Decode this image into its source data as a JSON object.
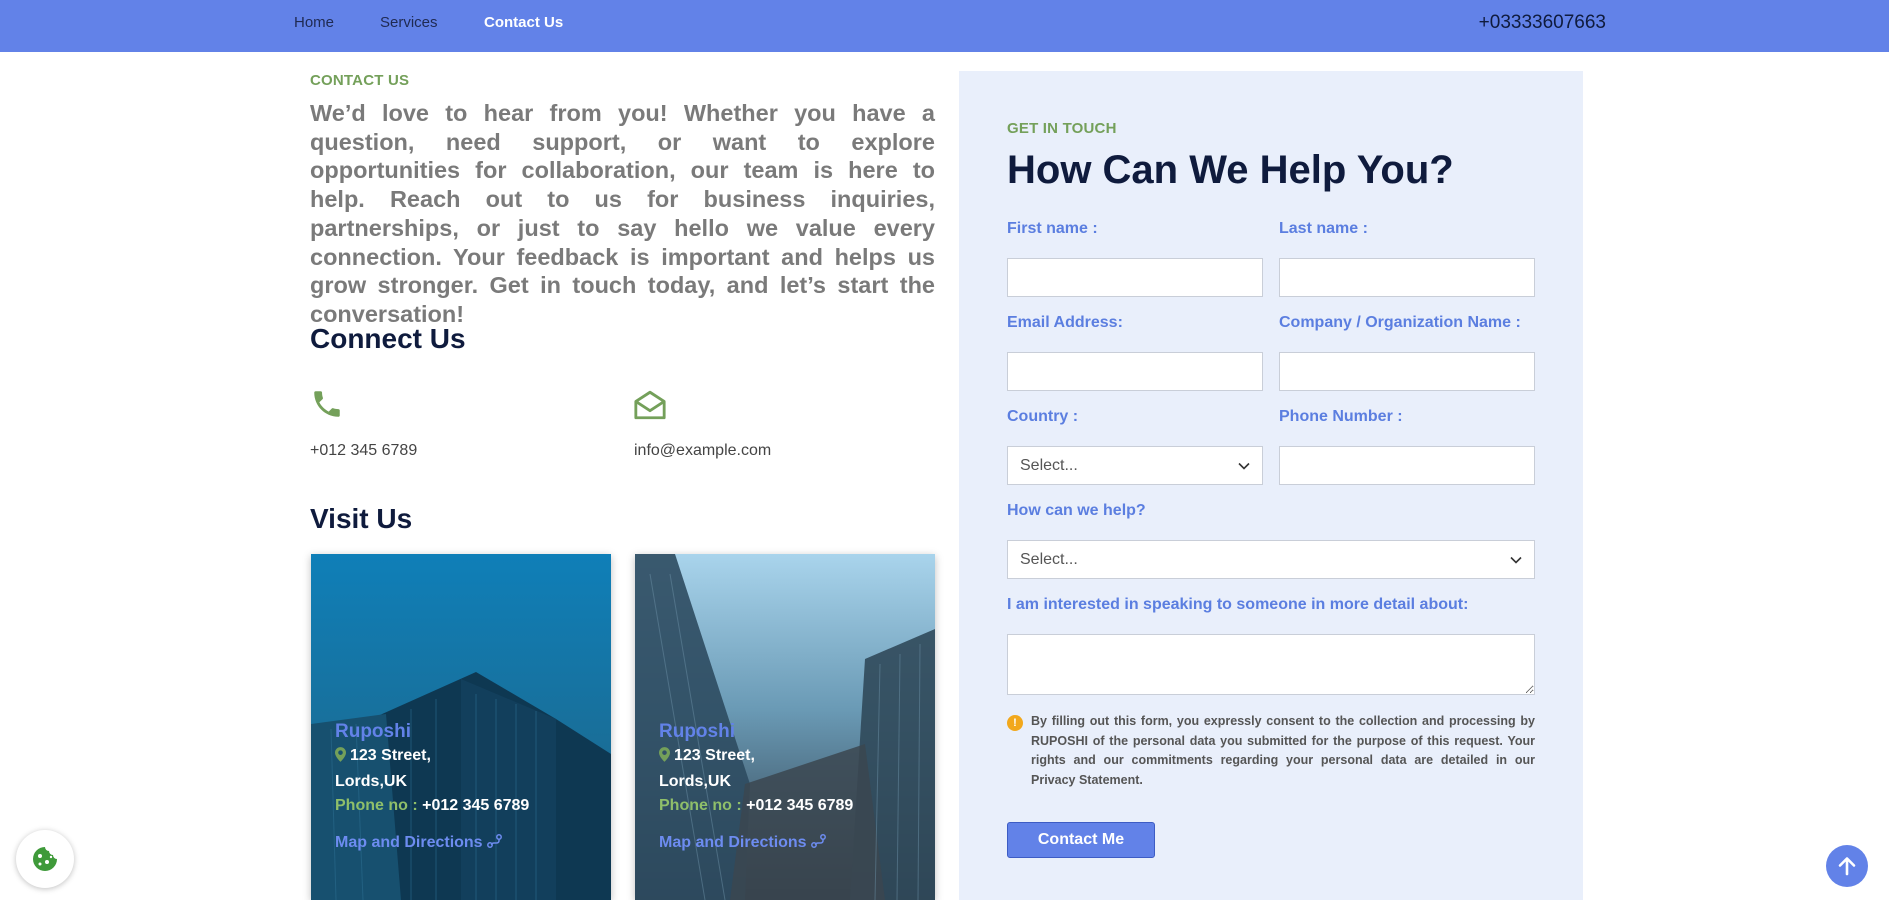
{
  "nav": {
    "home": "Home",
    "services": "Services",
    "contact": "Contact Us",
    "phone": "+03333607663"
  },
  "intro": {
    "eyebrow": "CONTACT US",
    "text": "We’d love to hear from you! Whether you have a question, need support, or want to explore opportunities for collaboration, our team is here to help. Reach out to us for business inquiries, partnerships, or just to say hello we value every connection. Your feedback is important and helps us grow stronger. Get in touch today, and let’s start the conversation!"
  },
  "connect": {
    "title": "Connect Us",
    "phone": "+012 345 6789",
    "email": "info@example.com"
  },
  "visit": {
    "title": "Visit Us",
    "cards": [
      {
        "name": "Ruposhi",
        "street": "123 Street,",
        "city": "Lords,UK",
        "phone_label": "Phone no :",
        "phone": "+012 345 6789",
        "link": "Map and Directions"
      },
      {
        "name": "Ruposhi",
        "street": "123 Street,",
        "city": "Lords,UK",
        "phone_label": "Phone no :",
        "phone": "+012 345 6789",
        "link": "Map and Directions"
      }
    ]
  },
  "form": {
    "eyebrow": "GET IN TOUCH",
    "title": "How Can We Help You?",
    "first_name_label": "First name :",
    "last_name_label": "Last name :",
    "email_label": "Email Address:",
    "company_label": "Company / Organization Name :",
    "country_label": "Country :",
    "country_value": "Select...",
    "phone_label": "Phone Number :",
    "help_label": "How can we help?",
    "help_value": "Select...",
    "detail_label": "I am interested in speaking to someone in more detail about:",
    "notice": "By filling out this form, you expressly consent to the collection and processing by RUPOSHI of the personal data you submitted for the purpose of this request. Your rights and our commitments regarding your personal data are detailed in our Privacy Statement.",
    "submit": "Contact Me"
  },
  "colors": {
    "brand": "#6282e8",
    "accent_green": "#74a05a",
    "panel_bg": "#e9effb",
    "heading": "#0f1b3d"
  }
}
